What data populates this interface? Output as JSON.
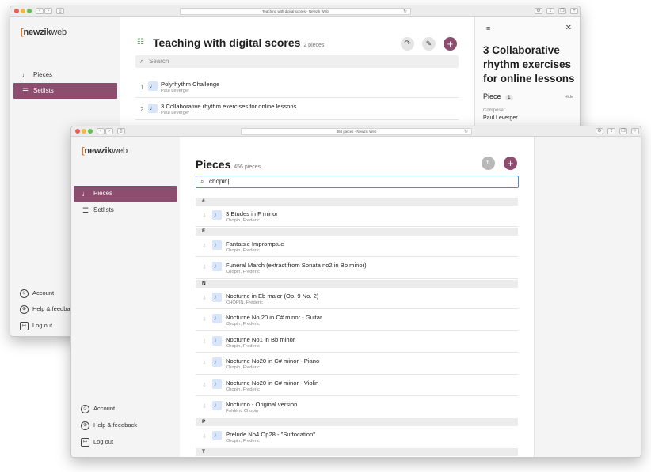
{
  "back_window": {
    "url": "Teaching with digital scores - Newzik Web",
    "logo": {
      "bracket": "[",
      "brand": "newzik",
      "suffix": "web"
    },
    "nav": [
      {
        "icon": "♩",
        "label": "Pieces"
      },
      {
        "icon": "☰",
        "label": "Setlists"
      }
    ],
    "footer": [
      {
        "icon": "☺",
        "label": "Account"
      },
      {
        "icon": "⊕",
        "label": "Help & feedback"
      },
      {
        "icon": "↦",
        "label": "Log out"
      }
    ],
    "title": "Teaching with digital scores",
    "count": "2 pieces",
    "search_placeholder": "Search",
    "rows": [
      {
        "num": "1",
        "title": "Polyrhythm Challenge",
        "subtitle": "Paul Leverger"
      },
      {
        "num": "2",
        "title": "3 Collaborative rhythm exercises for online lessons",
        "subtitle": "Paul Leverger"
      }
    ],
    "panel": {
      "title": "3 Collaborative rhythm exercises for online lessons",
      "section_label": "Piece",
      "section_count": "1",
      "hide_label": "Hide",
      "composer_label": "Composer",
      "composer_value": "Paul Leverger"
    }
  },
  "front_window": {
    "url": "456 pieces - Newzik Web",
    "logo": {
      "bracket": "[",
      "brand": "newzik",
      "suffix": "web"
    },
    "nav": [
      {
        "icon": "♩",
        "label": "Pieces"
      },
      {
        "icon": "☰",
        "label": "Setlists"
      }
    ],
    "footer": [
      {
        "icon": "☺",
        "label": "Account"
      },
      {
        "icon": "⊕",
        "label": "Help & feedback"
      },
      {
        "icon": "↦",
        "label": "Log out"
      }
    ],
    "title": "Pieces",
    "count": "456 pieces",
    "search_value": "chopin",
    "groups": [
      "#",
      "F",
      "N",
      "P",
      "T"
    ],
    "rows": [
      {
        "title": "3 Etudes in F minor",
        "subtitle": "Chopin, Frederic"
      },
      {
        "title": "Fantaisie Impromptue",
        "subtitle": "Chopin, Frederic"
      },
      {
        "title": "Funeral March (extract from Sonata no2 in Bb minor)",
        "subtitle": "Chopin, Frédéric"
      },
      {
        "title": "Nocturne in Eb major (Op. 9 No. 2)",
        "subtitle": "CHOPIN, Frédéric"
      },
      {
        "title": "Nocturne No.20 in C# minor - Guitar",
        "subtitle": "Chopin, Frederic"
      },
      {
        "title": "Nocturne No1 in Bb minor",
        "subtitle": "Chopin, Frederic"
      },
      {
        "title": "Nocturne No20 in C# minor - Piano",
        "subtitle": "Chopin, Frederic"
      },
      {
        "title": "Nocturne No20 in C# minor - Violin",
        "subtitle": "Chopin, Frederic"
      },
      {
        "title": "Nocturno - Original version",
        "subtitle": "Frédéric Chopin"
      },
      {
        "title": "Prelude No4 Op28 - \"Suffocation\"",
        "subtitle": "Chopin, Frederic"
      }
    ]
  },
  "colors": {
    "accent": "#8d4d6f",
    "sidebar": "#f4f4f4",
    "note_bg": "#d9e6f9"
  }
}
